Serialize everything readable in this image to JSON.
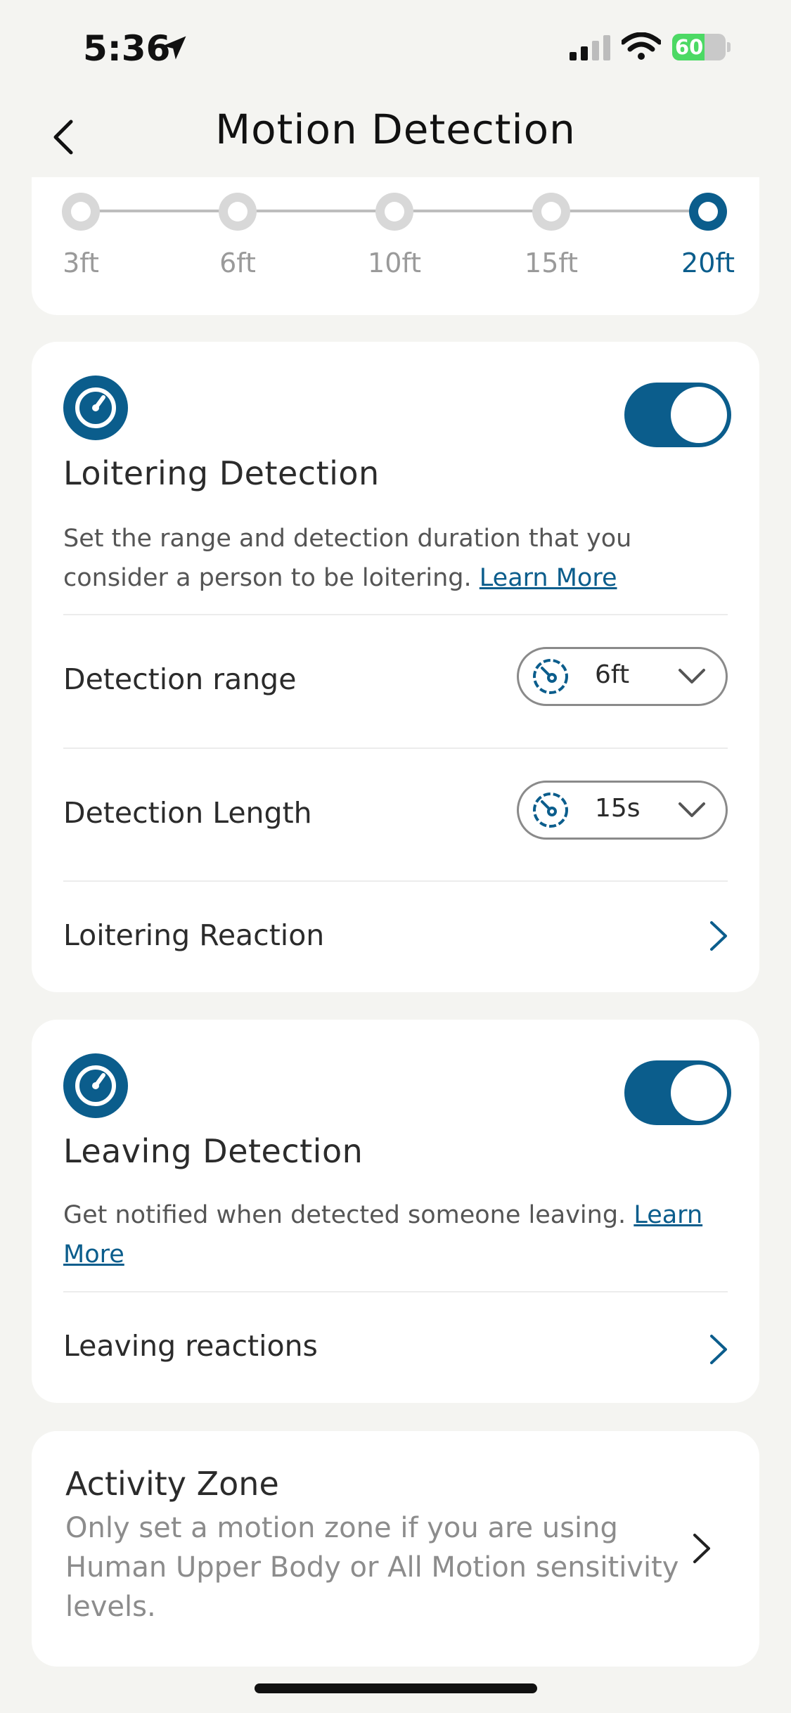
{
  "status_bar": {
    "time": "5:36",
    "battery": "60",
    "battery_level": 0.6,
    "battery_color": "#4cd964"
  },
  "nav": {
    "title": "Motion Detection"
  },
  "range_slider": {
    "options": [
      "3ft",
      "6ft",
      "10ft",
      "15ft",
      "20ft"
    ],
    "selected": "20ft",
    "accent": "#0b5d8c"
  },
  "loitering": {
    "icon": "gauge-icon",
    "title": "Loitering Detection",
    "toggle_on": true,
    "desc": "Set the range and detection duration that you consider a person to be loitering.",
    "learn_more": "Learn More",
    "rows": {
      "range_label": "Detection range",
      "range_value": "6ft",
      "length_label": "Detection Length",
      "length_value": "15s",
      "reaction_label": "Loitering Reaction"
    }
  },
  "leaving": {
    "icon": "gauge-icon",
    "title": "Leaving Detection",
    "toggle_on": true,
    "desc": "Get notified when detected someone leaving.",
    "learn_more": "Learn More",
    "reaction_label": "Leaving reactions"
  },
  "activity_zone": {
    "title": "Activity Zone",
    "desc": "Only set a motion zone if you are using Human Upper Body or All Motion sensitivity levels."
  }
}
